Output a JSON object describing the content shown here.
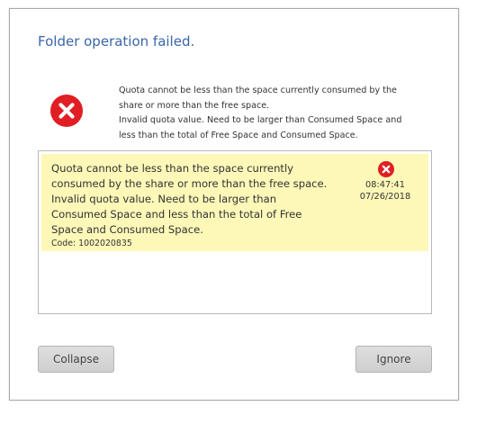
{
  "dialog": {
    "title": "Folder operation failed.",
    "summary_lines": [
      "Quota cannot be less than the space currently consumed by the",
      "share or more than the free space.",
      "Invalid quota value. Need to be larger than Consumed Space and",
      "less than the total of Free Space and Consumed Space."
    ],
    "error_icon": "error-x-icon",
    "colors": {
      "title": "#3a66a8",
      "error_red": "#e01e24",
      "log_highlight": "#fdf8b8",
      "button_bg": "#d6d6d6"
    }
  },
  "log": {
    "entries": [
      {
        "message_lines": [
          "Quota cannot be less than the space currently",
          "consumed by the share or more than the free space.",
          "Invalid quota value. Need to be larger than",
          "Consumed Space and less than the total of Free",
          "Space and Consumed Space."
        ],
        "code": "Code: 1002020835",
        "time": "08:47:41",
        "date": "07/26/2018",
        "icon": "error-x-icon"
      }
    ]
  },
  "buttons": {
    "collapse_label": "Collapse",
    "ignore_label": "Ignore"
  }
}
